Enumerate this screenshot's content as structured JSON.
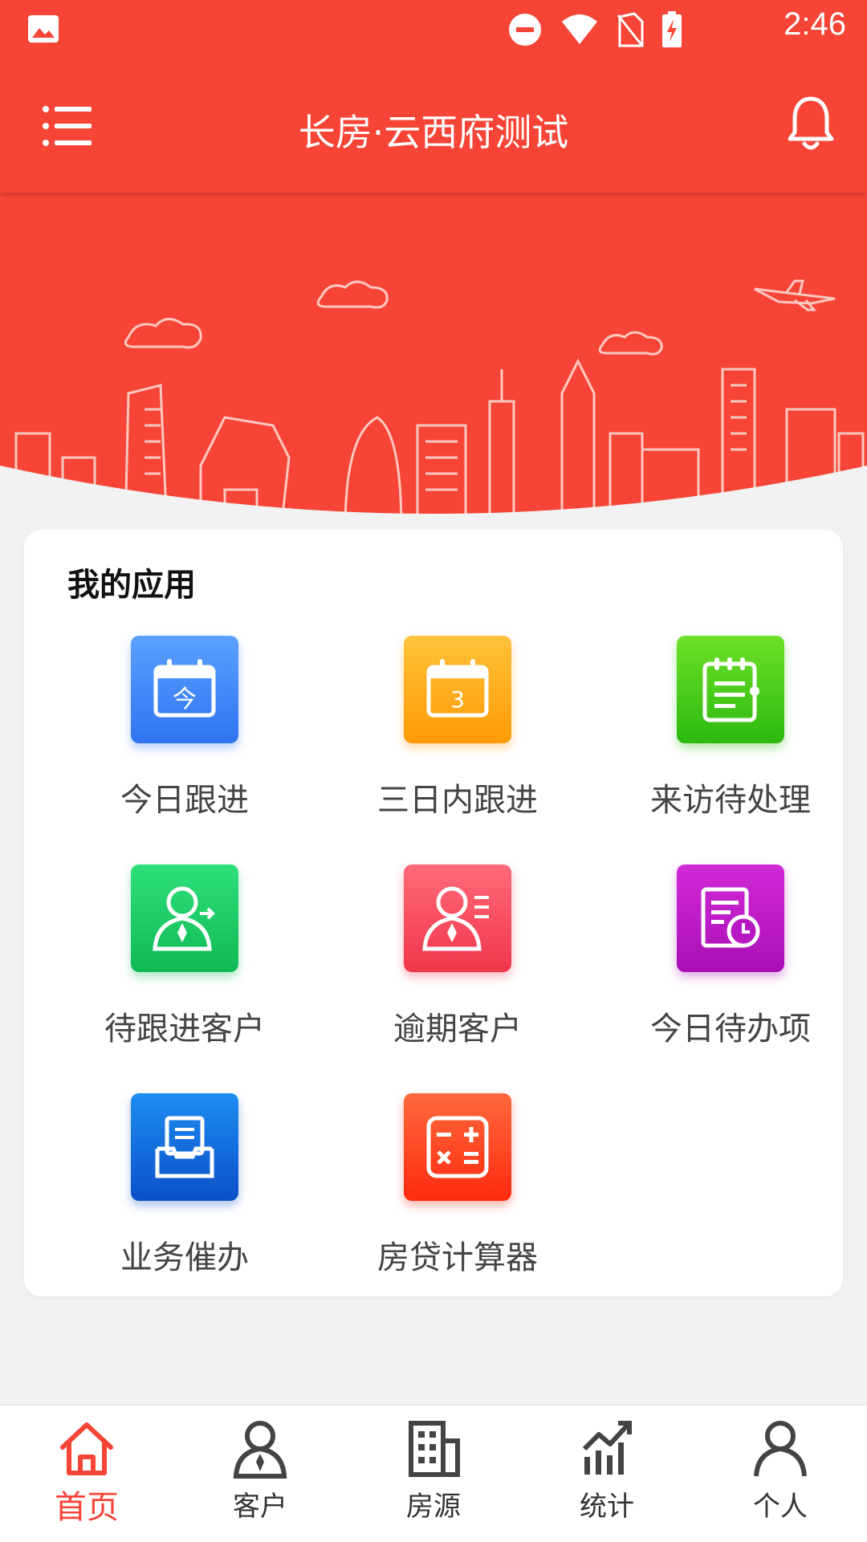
{
  "status_bar": {
    "time": "2:46",
    "icons": [
      "gallery-icon",
      "dnd-icon",
      "wifi-icon",
      "no-sim-icon",
      "battery-charging-icon"
    ]
  },
  "header": {
    "title": "长房·云西府测试",
    "menu_icon": "menu-icon",
    "bell_icon": "bell-icon"
  },
  "apps_section": {
    "title": "我的应用",
    "items": [
      {
        "label": "今日跟进",
        "icon": "calendar-today-icon",
        "tile_text": "今"
      },
      {
        "label": "三日内跟进",
        "icon": "calendar-three-day-icon",
        "tile_text": "3"
      },
      {
        "label": "来访待处理",
        "icon": "notepad-icon"
      },
      {
        "label": "待跟进客户",
        "icon": "user-forward-icon"
      },
      {
        "label": "逾期客户",
        "icon": "user-list-icon"
      },
      {
        "label": "今日待办项",
        "icon": "doc-clock-icon"
      },
      {
        "label": "业务催办",
        "icon": "inbox-doc-icon"
      },
      {
        "label": "房贷计算器",
        "icon": "calculator-icon"
      }
    ]
  },
  "tab_bar": {
    "tabs": [
      {
        "label": "首页",
        "icon": "home-icon",
        "active": true
      },
      {
        "label": "客户",
        "icon": "person-tie-icon"
      },
      {
        "label": "房源",
        "icon": "building-icon"
      },
      {
        "label": "统计",
        "icon": "stats-icon"
      },
      {
        "label": "个人",
        "icon": "person-icon"
      }
    ]
  },
  "colors": {
    "brand_red": "#f64536",
    "active_tab": "#f64536"
  }
}
